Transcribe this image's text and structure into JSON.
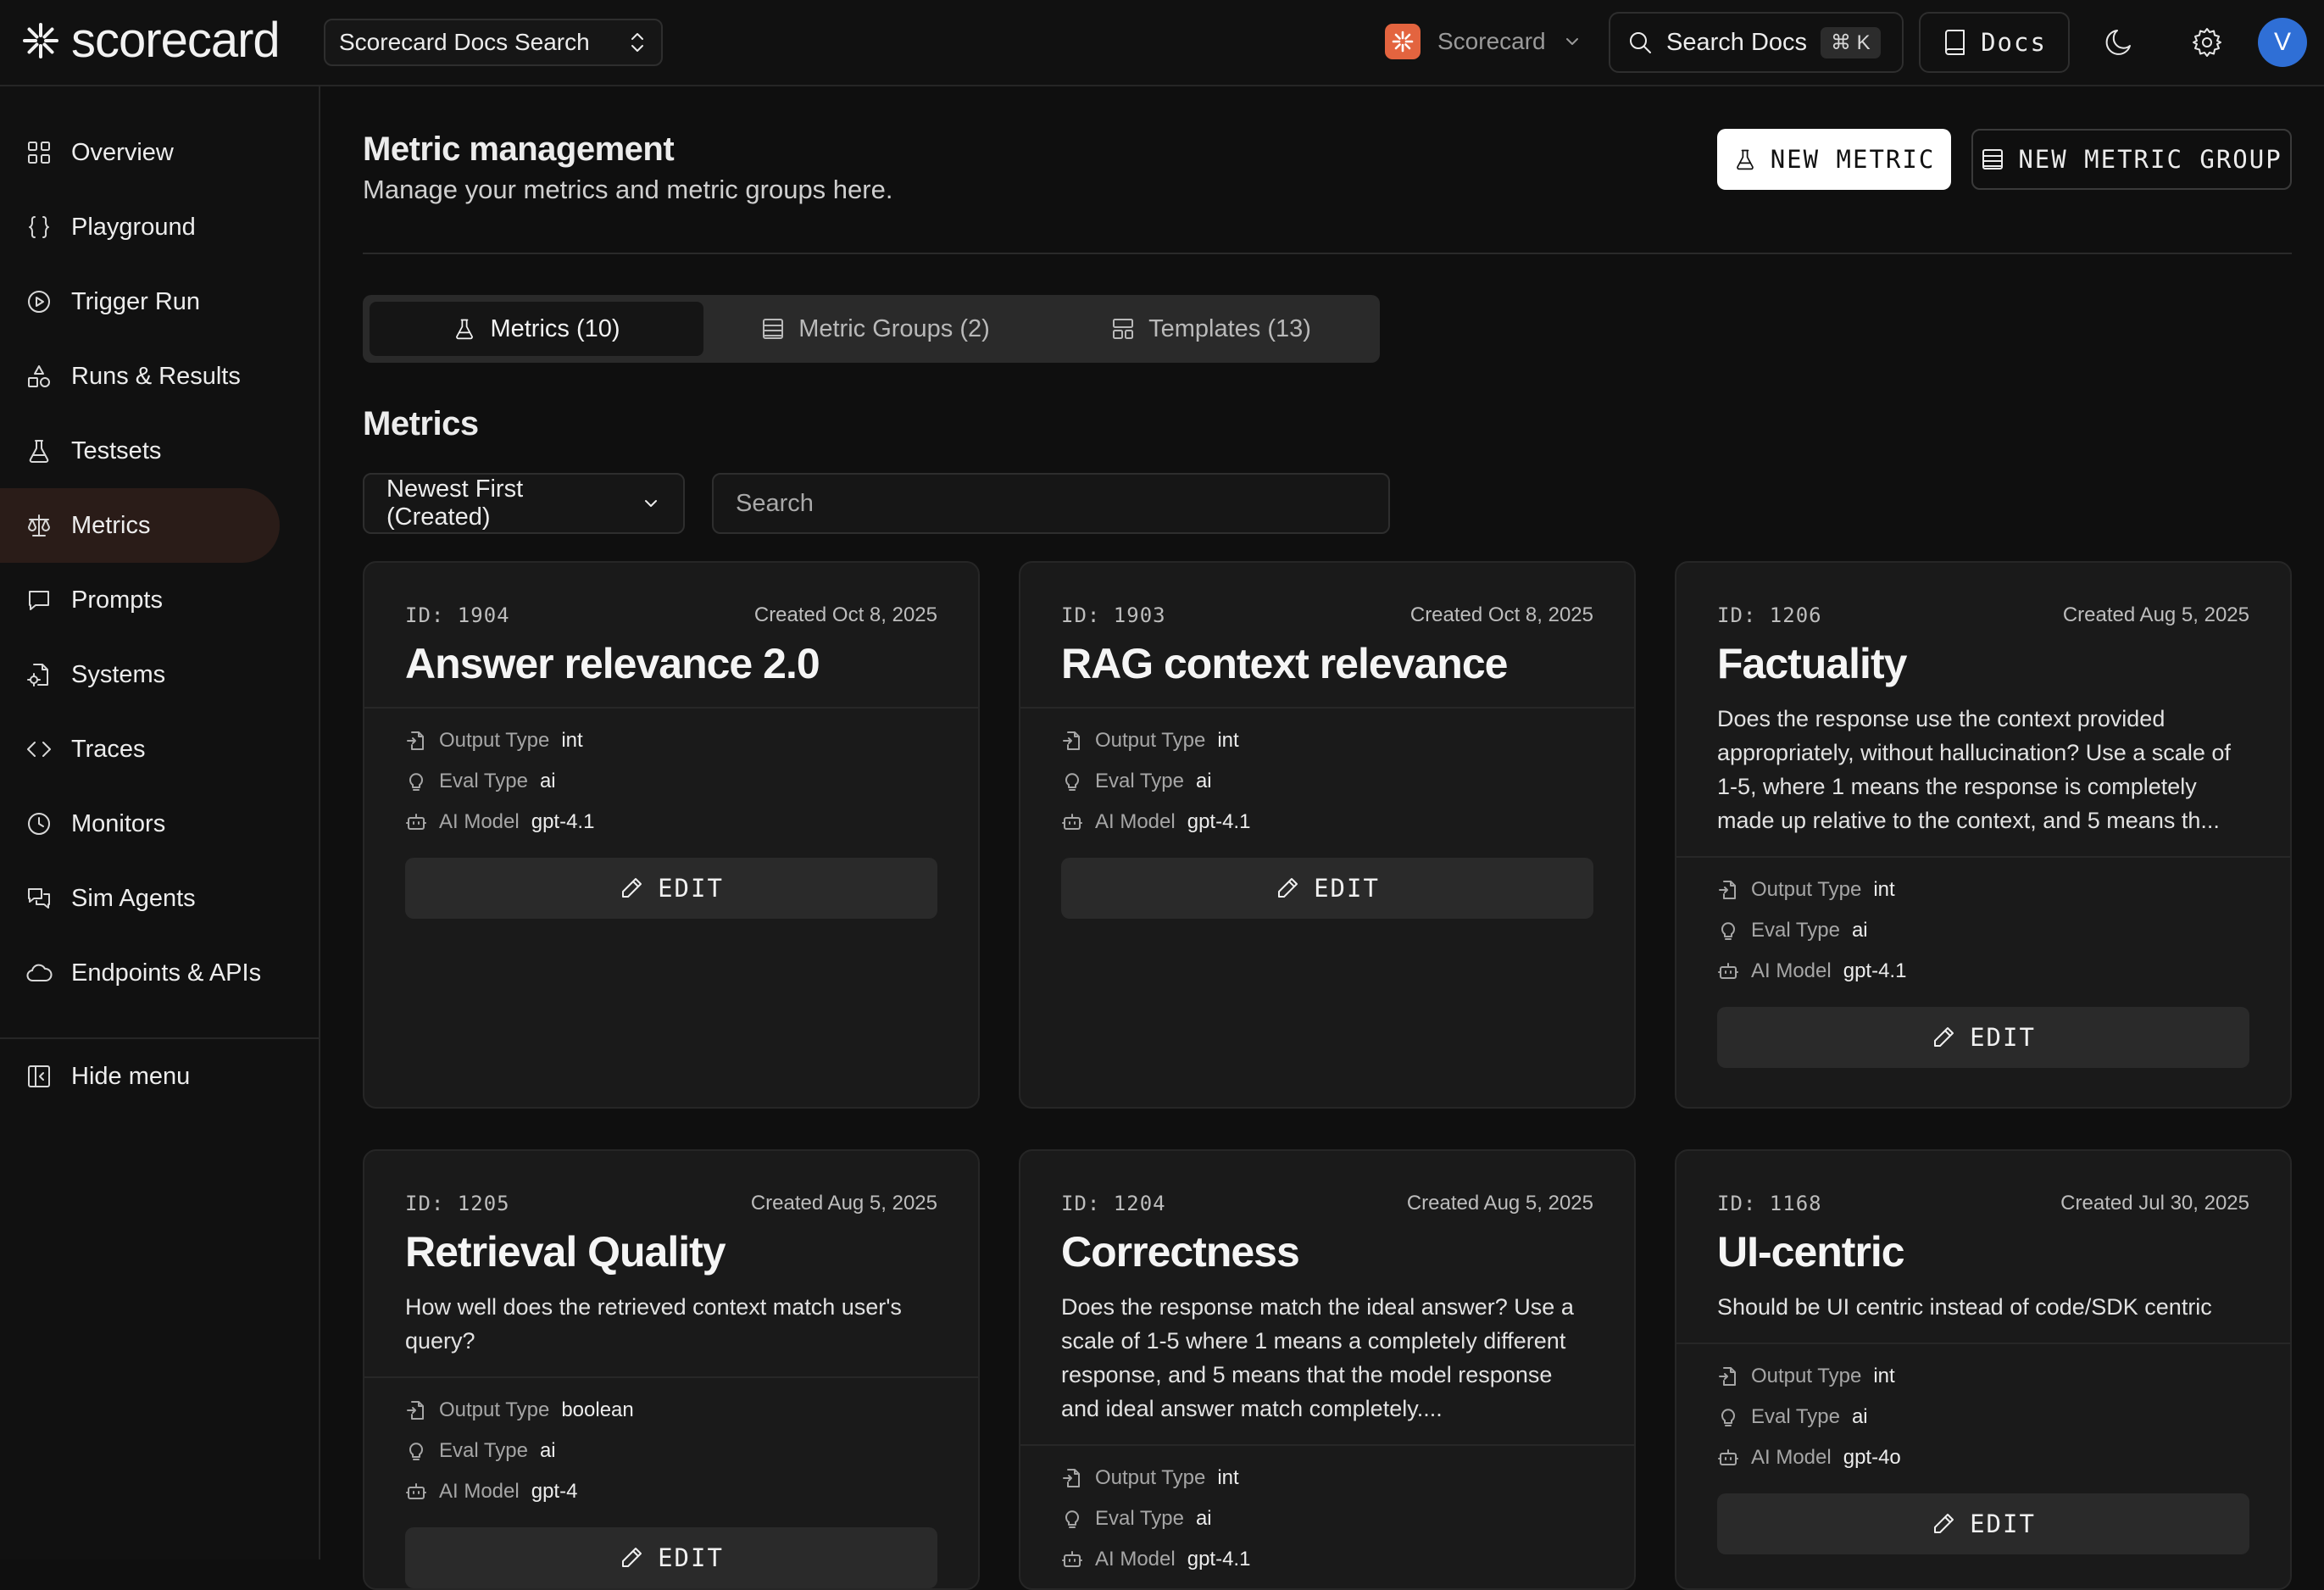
{
  "app": {
    "logo_text": "scorecard"
  },
  "topbar": {
    "docs_search_select": "Scorecard Docs Search",
    "org_name": "Scorecard",
    "search_docs_label": "Search Docs",
    "search_docs_shortcut": "⌘ K",
    "docs_label": "Docs",
    "avatar_initial": "V"
  },
  "sidebar": {
    "items": [
      {
        "label": "Overview",
        "icon": "grid-icon"
      },
      {
        "label": "Playground",
        "icon": "braces-icon"
      },
      {
        "label": "Trigger Run",
        "icon": "play-circle-icon"
      },
      {
        "label": "Runs & Results",
        "icon": "shapes-icon"
      },
      {
        "label": "Testsets",
        "icon": "flask-icon"
      },
      {
        "label": "Metrics",
        "icon": "scale-icon",
        "active": true
      },
      {
        "label": "Prompts",
        "icon": "message-square-icon"
      },
      {
        "label": "Systems",
        "icon": "file-cog-icon"
      },
      {
        "label": "Traces",
        "icon": "code-icon"
      },
      {
        "label": "Monitors",
        "icon": "clock-icon"
      },
      {
        "label": "Sim Agents",
        "icon": "messages-icon"
      },
      {
        "label": "Endpoints & APIs",
        "icon": "cloud-icon"
      }
    ],
    "hide_menu_label": "Hide menu"
  },
  "main": {
    "title": "Metric management",
    "subtitle": "Manage your metrics and metric groups here.",
    "new_metric_label": "NEW METRIC",
    "new_metric_group_label": "NEW METRIC GROUP",
    "tabs": [
      {
        "label": "Metrics (10)",
        "active": true
      },
      {
        "label": "Metric Groups (2)"
      },
      {
        "label": "Templates (13)"
      }
    ],
    "section_title": "Metrics",
    "sort_select": "Newest First (Created)",
    "search_placeholder": "Search",
    "attr_labels": {
      "output_type": "Output Type",
      "eval_type": "Eval Type",
      "ai_model": "AI Model"
    },
    "edit_label": "EDIT",
    "cards": [
      {
        "id": "ID: 1904",
        "created": "Created Oct 8, 2025",
        "title": "Answer relevance 2.0",
        "description": "",
        "output_type": "int",
        "eval_type": "ai",
        "ai_model": "gpt-4.1"
      },
      {
        "id": "ID: 1903",
        "created": "Created Oct 8, 2025",
        "title": "RAG context relevance",
        "description": "",
        "output_type": "int",
        "eval_type": "ai",
        "ai_model": "gpt-4.1"
      },
      {
        "id": "ID: 1206",
        "created": "Created Aug 5, 2025",
        "title": "Factuality",
        "description": "Does the response use the context provided appropriately, without hallucination? Use a scale of 1-5, where 1 means the response is completely made up relative to the context, and 5 means th...",
        "output_type": "int",
        "eval_type": "ai",
        "ai_model": "gpt-4.1"
      },
      {
        "id": "ID: 1205",
        "created": "Created Aug 5, 2025",
        "title": "Retrieval Quality",
        "description": "How well does the retrieved context match user's query?",
        "output_type": "boolean",
        "eval_type": "ai",
        "ai_model": "gpt-4"
      },
      {
        "id": "ID: 1204",
        "created": "Created Aug 5, 2025",
        "title": "Correctness",
        "description": "Does the response match the ideal answer? Use a scale of 1-5 where 1 means a completely different response, and 5 means that the model response and ideal answer match completely....",
        "output_type": "int",
        "eval_type": "ai",
        "ai_model": "gpt-4.1"
      },
      {
        "id": "ID: 1168",
        "created": "Created Jul 30, 2025",
        "title": "UI-centric",
        "description": "Should be UI centric instead of code/SDK centric",
        "output_type": "int",
        "eval_type": "ai",
        "ai_model": "gpt-4o"
      }
    ]
  },
  "colors": {
    "background": "#0f0f0f",
    "card": "#1a1a1a",
    "accent_org": "#e3643f",
    "avatar": "#2f6fd6",
    "active_nav": "#2a1c18"
  }
}
